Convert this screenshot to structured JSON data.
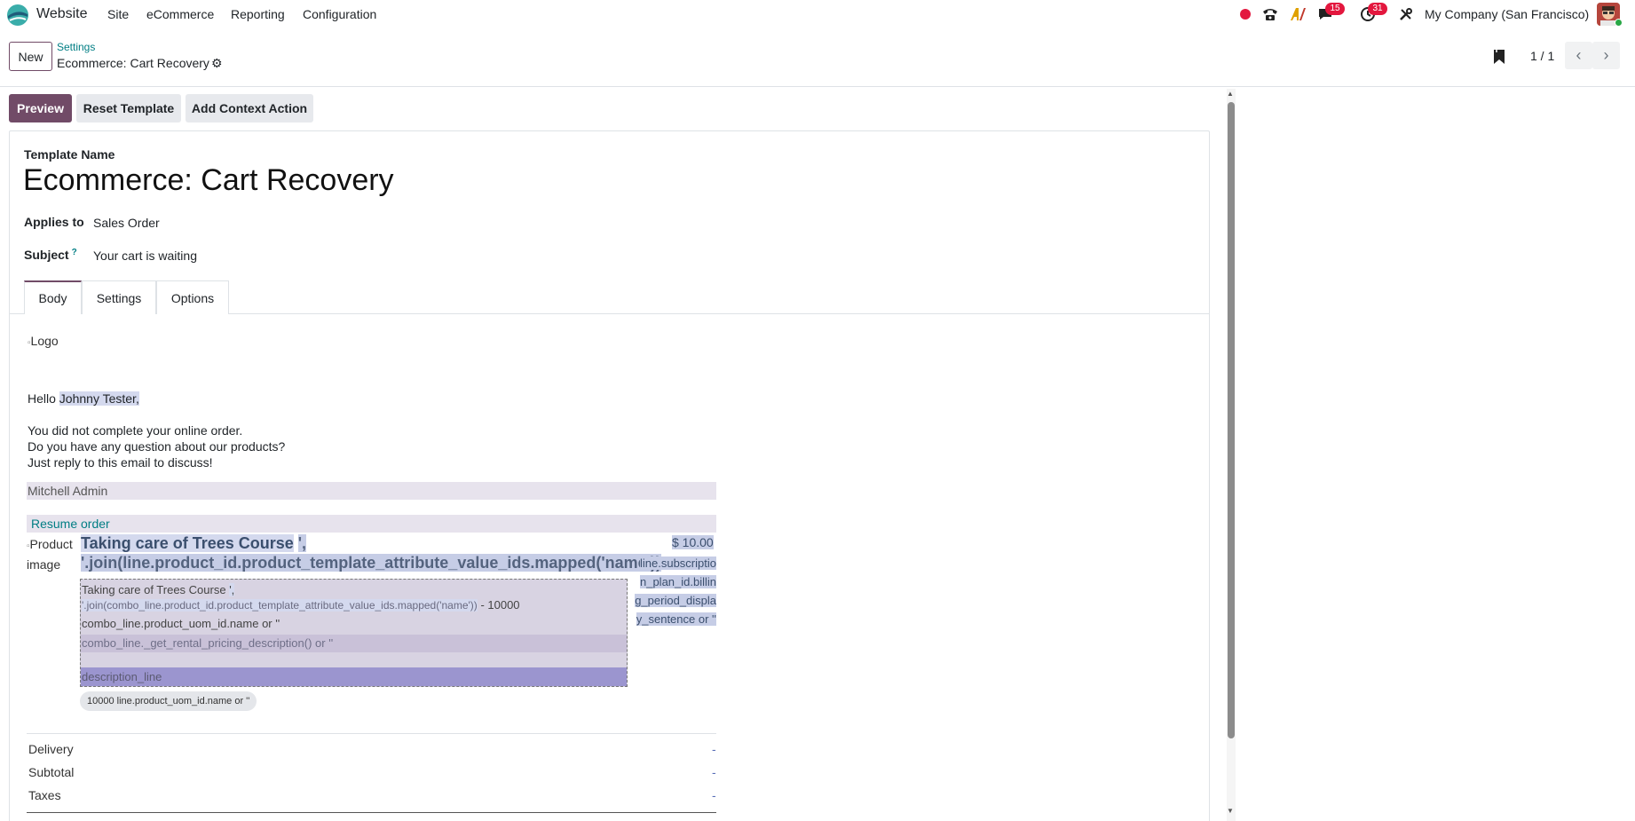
{
  "navbar": {
    "app_name": "Website",
    "menus": [
      "Site",
      "eCommerce",
      "Reporting",
      "Configuration"
    ],
    "messages_count": "15",
    "activities_count": "31",
    "company": "My Company (San Francisco)",
    "icons": [
      "recording-dot-icon",
      "phone-icon",
      "ai-icon",
      "chat-icon",
      "clock-icon",
      "tools-icon"
    ]
  },
  "control": {
    "new_label": "New",
    "breadcrumb_parent": "Settings",
    "breadcrumb_current": "Ecommerce: Cart Recovery",
    "pager": "1 / 1"
  },
  "actions": {
    "preview": "Preview",
    "reset": "Reset Template",
    "context": "Add Context Action"
  },
  "form": {
    "template_name_label": "Template Name",
    "template_name": "Ecommerce: Cart Recovery",
    "applies_to_label": "Applies to",
    "applies_to": "Sales Order",
    "subject_label": "Subject",
    "subject_help": "?",
    "subject": "Your cart is waiting",
    "tabs": [
      "Body",
      "Settings",
      "Options"
    ]
  },
  "email": {
    "logo_alt": "Logo",
    "hello": "Hello",
    "customer": "Johnny Tester",
    "comma": ",",
    "line1": "You did not complete your online order.",
    "line2": "Do you have any question about our products?",
    "line3": "Just reply to this email to discuss!",
    "salesperson": "Mitchell Admin",
    "resume": "Resume order",
    "product_image_alt": "Product image",
    "product_name": "Taking care of Trees Course",
    "product_attr": "', '.join(line.product_id.product_template_attribute_value_ids.mapped('name'))",
    "price": "$ 10.00",
    "subscription_lines": [
      "line.subscriptio",
      "n_plan_id.billin",
      "g_period_displa",
      "y_sentence or ''"
    ],
    "combo_name": "Taking care of Trees Course",
    "combo_attr_sep": "',",
    "combo_attr": "'.join(combo_line.product_id.product_template_attribute_value_ids.mapped('name'))",
    "combo_qty": "- 10000",
    "combo_uom": "combo_line.product_uom_id.name or ''",
    "combo_rental": "combo_line._get_rental_pricing_description() or ''",
    "description_line": "description_line",
    "uom_chip": "10000 line.product_uom_id.name or ''",
    "totals": [
      "Delivery",
      "Subtotal",
      "Taxes"
    ],
    "total_value": "-"
  },
  "colors": {
    "brand": "#714b67",
    "link": "#017e84",
    "badge": "#e3173e"
  }
}
